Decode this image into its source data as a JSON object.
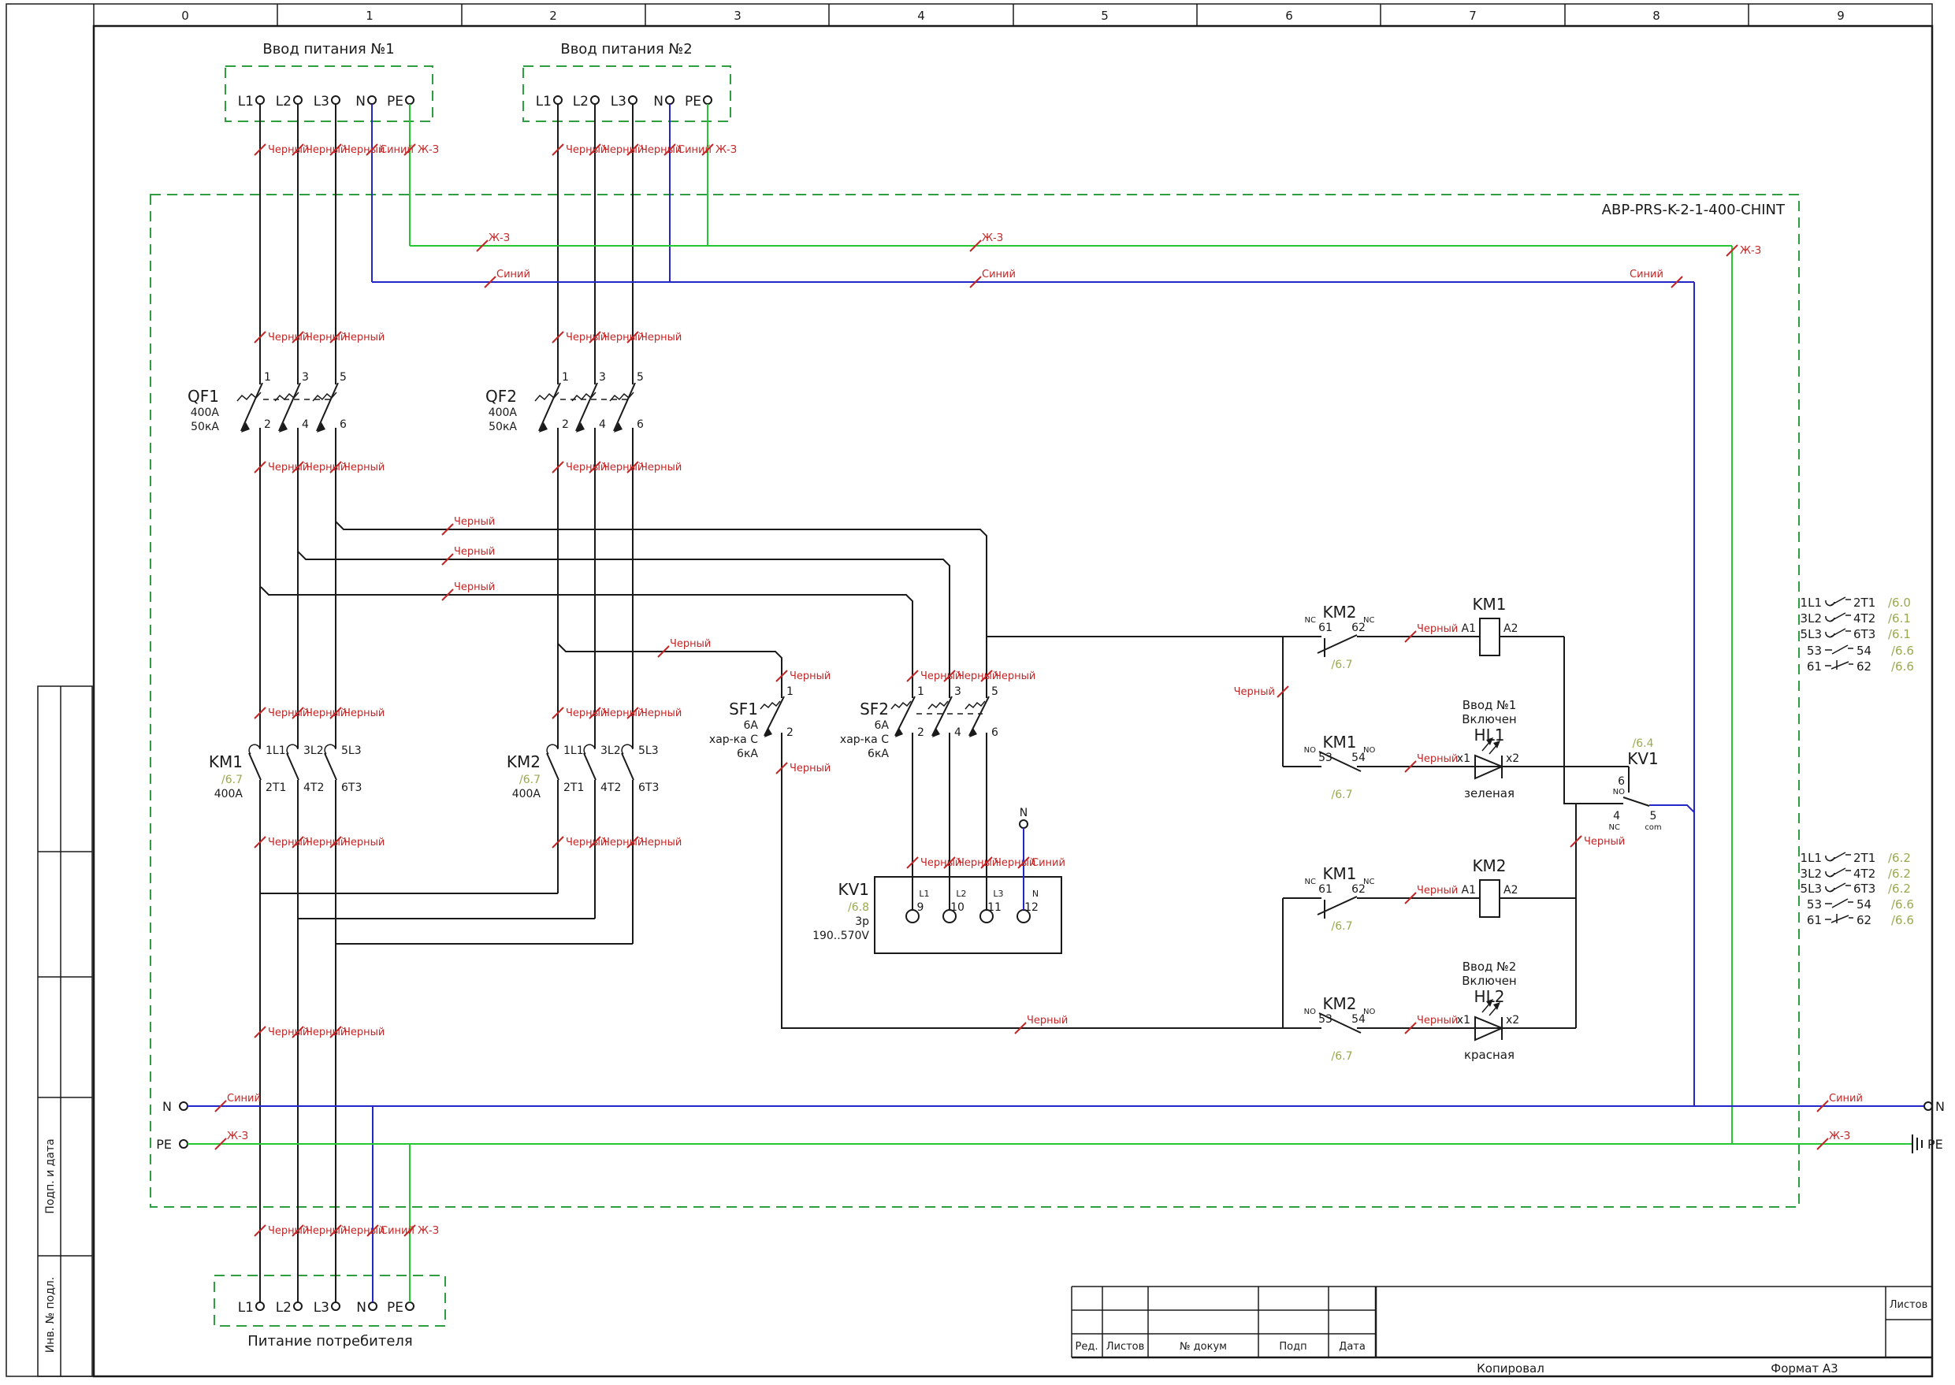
{
  "ruler": [
    "0",
    "1",
    "2",
    "3",
    "4",
    "5",
    "6",
    "7",
    "8",
    "9"
  ],
  "side": {
    "s1": "Подп. и дата",
    "s2": "Инв. № подл."
  },
  "panel": {
    "label": "АВР-PRS-K-2-1-400-CHINT"
  },
  "src": {
    "in1": "Ввод питания №1",
    "in2": "Ввод питания №2",
    "out": "Питание потребителя",
    "t": [
      "L1",
      "L2",
      "L3",
      "N",
      "PE"
    ]
  },
  "wire": {
    "blk": "Черный",
    "blu": "Синий",
    "yg": "Ж-З"
  },
  "qf": {
    "qf1": "QF1",
    "qf2": "QF2",
    "a": "400A",
    "ka": "50кА",
    "n": [
      "1",
      "2",
      "3",
      "4",
      "5",
      "6"
    ]
  },
  "sf": {
    "sf1": "SF1",
    "sf2": "SF2",
    "a": "6A",
    "ch": "хар-ка С",
    "ka": "6кА"
  },
  "km": {
    "km1": "KM1",
    "km2": "KM2",
    "a": "400A",
    "ref": "/6.7",
    "t": [
      "1L1",
      "2T1",
      "3L2",
      "4T2",
      "5L3",
      "6T3"
    ]
  },
  "kv": {
    "name": "KV1",
    "ref": "/6.8",
    "p": "3p",
    "u": "190..570V",
    "ph": [
      "L1",
      "L2",
      "L3",
      "N"
    ],
    "tn": [
      "9",
      "10",
      "11",
      "12"
    ],
    "n": "N"
  },
  "aux": {
    "nc": "NC",
    "no": "NO",
    "c61": "61",
    "c62": "62",
    "c53": "53",
    "c54": "54"
  },
  "coil": {
    "a1": "A1",
    "a2": "A2"
  },
  "hl": {
    "hl1": "HL1",
    "hl2": "HL2",
    "cap1": "Ввод №1",
    "cap2": "Ввод №2",
    "on": "Включен",
    "grn": "зеленая",
    "red": "красная",
    "x1": "x1",
    "x2": "x2"
  },
  "kvr": {
    "ref": "/6.4",
    "name": "KV1",
    "t6": "6",
    "no": "NO",
    "t4": "4",
    "nc": "NC",
    "t5": "5",
    "com": "com"
  },
  "xr1": [
    {
      "l": "1L1",
      "r": "2T1",
      "f": "/6.0"
    },
    {
      "l": "3L2",
      "r": "4T2",
      "f": "/6.1"
    },
    {
      "l": "5L3",
      "r": "6T3",
      "f": "/6.1"
    },
    {
      "l": "53",
      "r": "54",
      "f": "/6.6"
    },
    {
      "l": "61",
      "r": "62",
      "f": "/6.6"
    }
  ],
  "xr2": [
    {
      "l": "1L1",
      "r": "2T1",
      "f": "/6.2"
    },
    {
      "l": "3L2",
      "r": "4T2",
      "f": "/6.2"
    },
    {
      "l": "5L3",
      "r": "6T3",
      "f": "/6.2"
    },
    {
      "l": "53",
      "r": "54",
      "f": "/6.6"
    },
    {
      "l": "61",
      "r": "62",
      "f": "/6.6"
    }
  ],
  "bus": {
    "n": "N",
    "pe": "PE"
  },
  "tb": {
    "r": "Ред.",
    "l": "Листов",
    "d": "№ докум",
    "p": "Подп",
    "dt": "Дата",
    "copy": "Копировал",
    "fmt": "Формат А3",
    "sh": "Листов"
  }
}
